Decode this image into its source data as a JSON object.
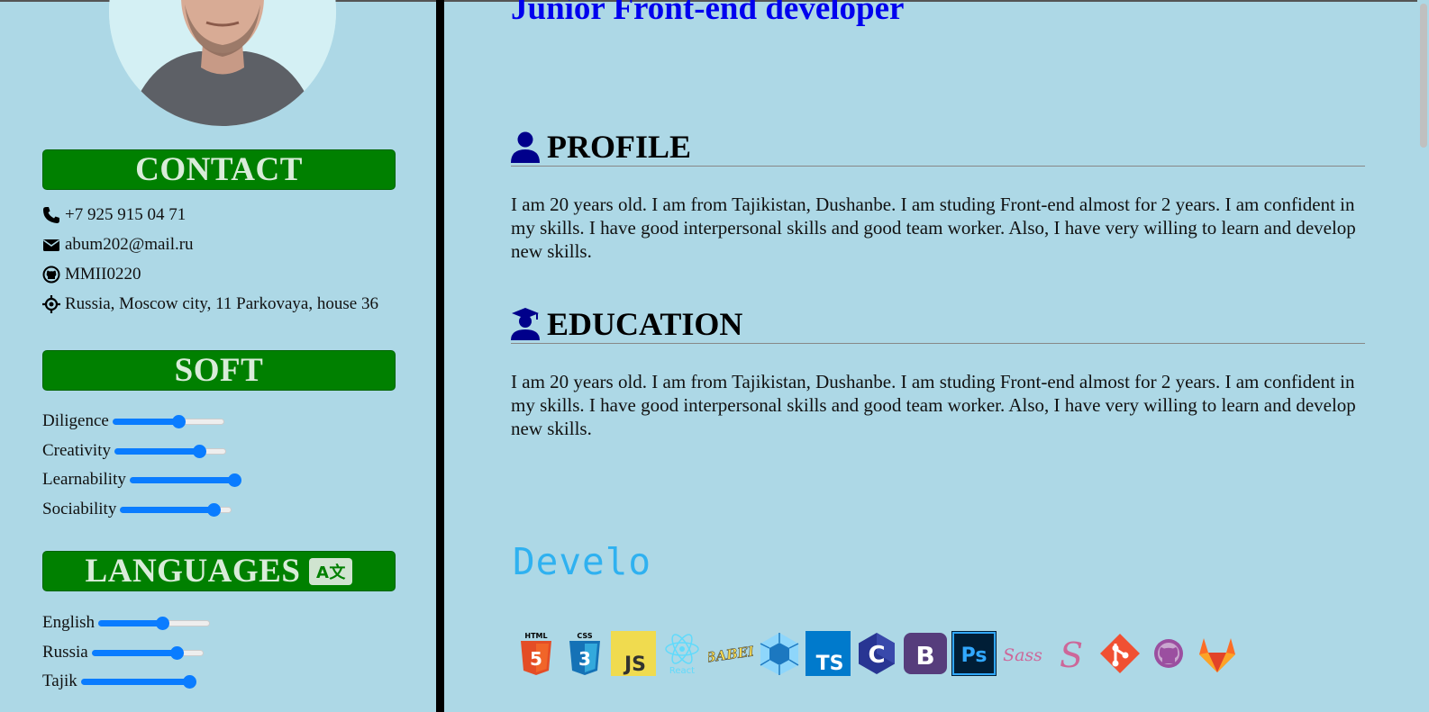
{
  "sidebar": {
    "contact": {
      "title": "CONTACT",
      "items": [
        {
          "icon": "phone-icon",
          "text": "+7 925 915 04 71"
        },
        {
          "icon": "envelope-icon",
          "text": "abum202@mail.ru"
        },
        {
          "icon": "github-icon",
          "text": "MMII0220"
        },
        {
          "icon": "location-icon",
          "text": "Russia, Moscow city, 11 Parkovaya, house 36"
        }
      ]
    },
    "soft": {
      "title": "SOFT",
      "skills": [
        {
          "label": "Diligence",
          "level": 0.6
        },
        {
          "label": "Creativity",
          "level": 0.78
        },
        {
          "label": "Learnability",
          "level": 1.0
        },
        {
          "label": "Sociability",
          "level": 0.86
        }
      ]
    },
    "languages": {
      "title": "LANGUAGES",
      "icon_text": "A文",
      "items": [
        {
          "label": "English",
          "level": 0.58
        },
        {
          "label": "Russia",
          "level": 0.78
        },
        {
          "label": "Tajik",
          "level": 1.0
        }
      ]
    }
  },
  "main": {
    "job_title": "Junior Front-end developer",
    "profile": {
      "heading": "PROFILE",
      "text": "I am 20 years old. I am from Tajikistan, Dushanbe. I am studing Front-end almost for 2 years. I am confident in my skills. I have good interpersonal skills and good team worker. Also, I have very willing to learn and develop new skills."
    },
    "education": {
      "heading": "EDUCATION",
      "text": "I am 20 years old. I am from Tajikistan, Dushanbe. I am studing Front-end almost for 2 years. I am confident in my skills. I have good interpersonal skills and good team worker. Also, I have very willing to learn and develop new skills."
    },
    "typing_text": "Develo",
    "tech_icons": [
      {
        "name": "html5-icon",
        "label": "HTML",
        "badge": "5"
      },
      {
        "name": "css3-icon",
        "label": "CSS",
        "badge": "3"
      },
      {
        "name": "javascript-icon",
        "badge": "JS"
      },
      {
        "name": "react-icon",
        "badge": "React"
      },
      {
        "name": "babel-icon",
        "badge": "BABEL"
      },
      {
        "name": "webpack-icon"
      },
      {
        "name": "typescript-icon",
        "badge": "TS"
      },
      {
        "name": "c-icon",
        "badge": "C"
      },
      {
        "name": "bootstrap-icon",
        "badge": "B"
      },
      {
        "name": "photoshop-icon",
        "badge": "Ps"
      },
      {
        "name": "sass-icon",
        "badge": "Sass"
      },
      {
        "name": "sass-logo-icon",
        "badge": "S"
      },
      {
        "name": "git-icon"
      },
      {
        "name": "github-icon"
      },
      {
        "name": "gitlab-icon"
      }
    ],
    "colors": {
      "background": "#add8e6",
      "section_bar": "#008000",
      "slider": "#0a7cff",
      "job_title": "#0000ee",
      "typing": "#2fb1f0"
    }
  }
}
